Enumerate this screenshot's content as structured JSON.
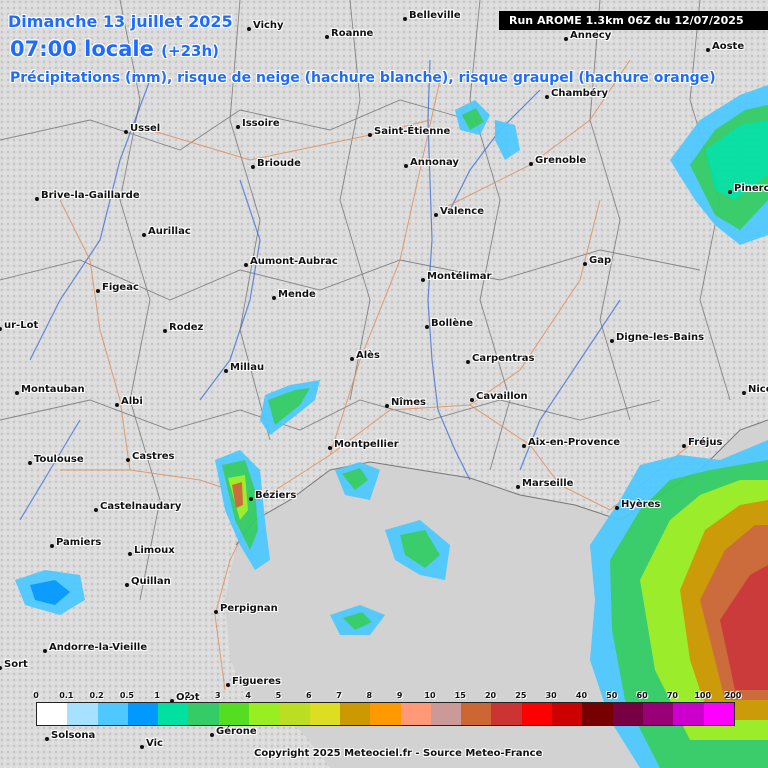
{
  "header": {
    "date": "Dimanche 13 juillet 2025",
    "time": "07:00 locale",
    "offset": "(+23h)",
    "subtitle": "Précipitations (mm), risque de neige (hachure blanche), risque graupel (hachure orange)",
    "run": "Run AROME 1.3km 06Z du 12/07/2025"
  },
  "copyright": "Copyright 2025 Meteociel.fr - Source Meteo-France",
  "cities": [
    "Vichy",
    "Belleville",
    "Roanne",
    "Annecy",
    "Aoste",
    "Ussel",
    "Issoire",
    "Saint-Étienne",
    "Chambéry",
    "Brioude",
    "Annonay",
    "Grenoble",
    "Pinerolo",
    "Brive-la-Gaillarde",
    "Valence",
    "Aurillac",
    "Aumont-Aubrac",
    "Montélimar",
    "Gap",
    "Figeac",
    "Mende",
    "ur-Lot",
    "Rodez",
    "Bollène",
    "Digne-les-Bains",
    "Millau",
    "Alès",
    "Carpentras",
    "Montauban",
    "Albi",
    "Nîmes",
    "Cavaillon",
    "Nice",
    "Aix-en-Provence",
    "Fréjus",
    "Montpellier",
    "Toulouse",
    "Castres",
    "Marseille",
    "Béziers",
    "Hyères",
    "Castelnaudary",
    "Pamiers",
    "Limoux",
    "Quillan",
    "Perpignan",
    "Andorre-la-Vieille",
    "Sort",
    "Figueres",
    "Olot",
    "Gérone",
    "Solsona",
    "Vic"
  ],
  "legend": {
    "labels": [
      "0",
      "0.1",
      "0.2",
      "0.5",
      "1",
      "2",
      "3",
      "4",
      "5",
      "6",
      "7",
      "8",
      "9",
      "10",
      "15",
      "20",
      "25",
      "30",
      "40",
      "50",
      "60",
      "70",
      "100",
      "200"
    ],
    "colors": [
      "#ffffff",
      "#a6e1ff",
      "#4fc8ff",
      "#0099ff",
      "#00e0a0",
      "#33cc66",
      "#55dd22",
      "#99ee22",
      "#bbdd22",
      "#dddd22",
      "#cc9900",
      "#ff9900",
      "#ff9977",
      "#cc9999",
      "#cc6633",
      "#cc3333",
      "#ff0000",
      "#cc0000",
      "#770000",
      "#770044",
      "#990077",
      "#cc00cc",
      "#ff00ff"
    ]
  },
  "colors": {
    "title": "#1e6cff",
    "land": "#d7d7d7",
    "sea": "#d0d0d0"
  }
}
